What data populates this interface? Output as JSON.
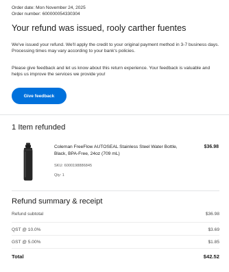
{
  "order": {
    "date_text": "Order date: Mon November 24, 2025",
    "number_text": "Order number: 600000054330304"
  },
  "header": {
    "headline": "Your refund was issued, rooly carther fuentes"
  },
  "body": {
    "paragraph_1": "We've issued your refund. We'll apply the credit to your original payment method in 3-7 business days. Processing times may vary according to your bank's policies.",
    "paragraph_2": "Please give feedback and let us know about this return experience. Your feedback is valuable and helps us improve the services we provide you!"
  },
  "feedback_button": {
    "label": "Give feedback",
    "color": "#0071dc"
  },
  "items_section": {
    "title": "1 Item refunded",
    "items": [
      {
        "name": "Coleman FreeFlow AUTOSEAL Stainless Steel Water Bottle, Black, BPA-Free, 24oz (709 mL)",
        "price": "$36.98",
        "sku": "SKU: 6000198886845",
        "qty": "Qty: 1",
        "image_icon": "water-bottle-image"
      }
    ]
  },
  "summary": {
    "title": "Refund summary & receipt",
    "rows": [
      {
        "label": "Refund subtotal",
        "value": "$36.98"
      },
      {
        "label": "QST @ 10.0%",
        "value": "$3.69"
      },
      {
        "label": "GST @ 5.00%",
        "value": "$1.85"
      }
    ],
    "total": {
      "label": "Total",
      "value": "$42.52"
    }
  }
}
